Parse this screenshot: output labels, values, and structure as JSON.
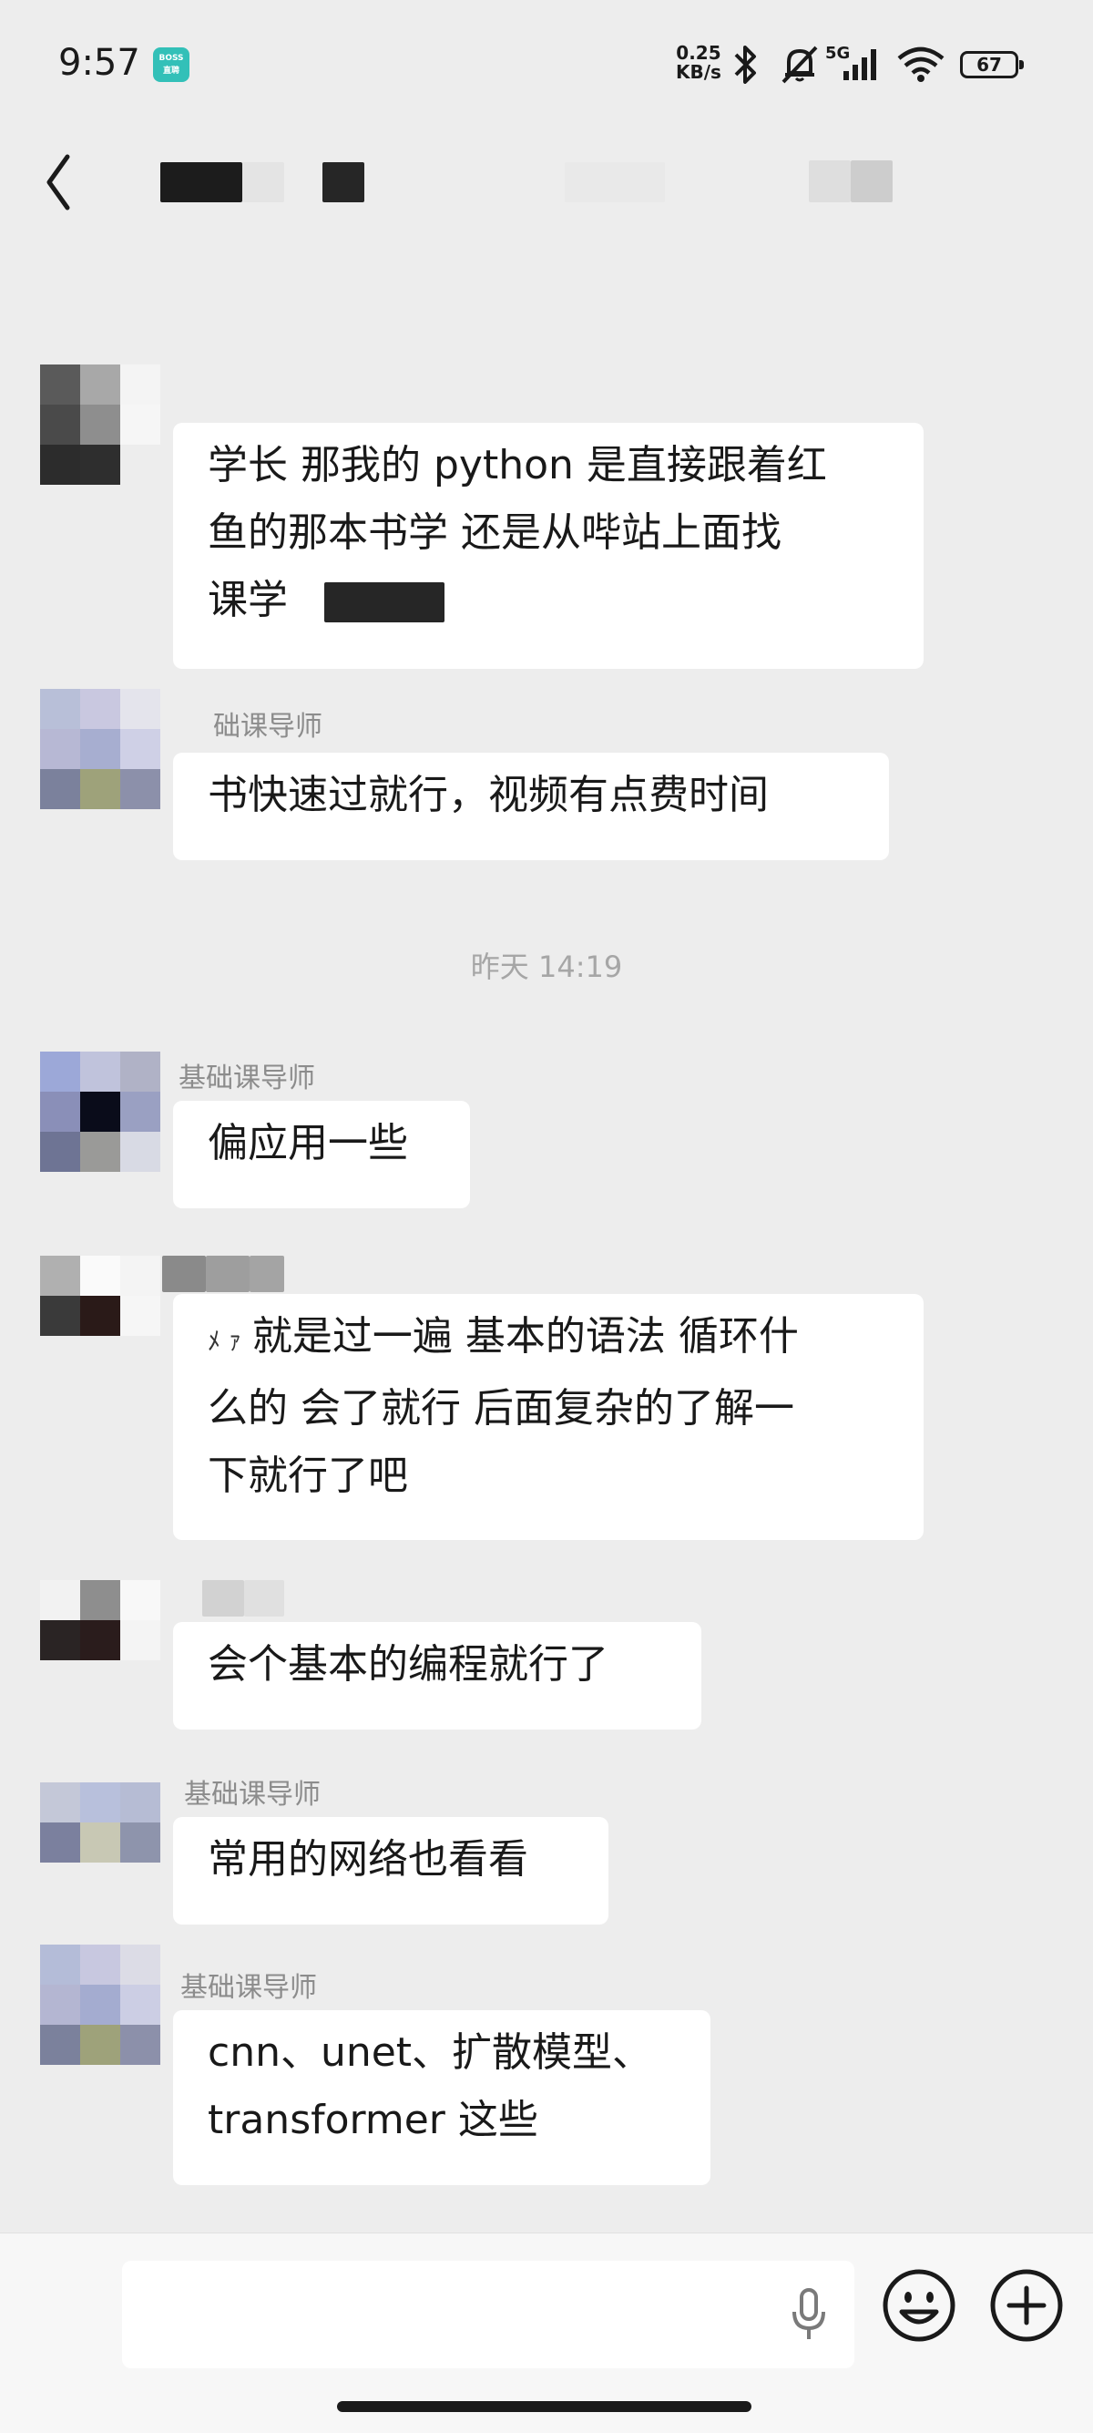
{
  "status_bar": {
    "time": "9:57",
    "boss_badge": "BOSS\n直聘",
    "net_speed_value": "0.25",
    "net_speed_unit": "KB/s",
    "network": "5G",
    "battery": "67",
    "icons": [
      "bluetooth-icon",
      "bell-muted-icon",
      "signal-icon",
      "wifi-icon",
      "battery-icon"
    ]
  },
  "header": {
    "back_icon": "chevron-left-icon"
  },
  "messages": [
    {
      "lines": [
        "学长 那我的 python 是直接跟着红",
        "鱼的那本书学 还是从哔站上面找",
        "课学"
      ]
    },
    {
      "sender": "础课导师",
      "lines": [
        "书快速过就行，视频有点费时间"
      ]
    },
    {
      "timestamp": "昨天 14:19"
    },
    {
      "sender": "基础课导师",
      "lines": [
        "偏应用一些"
      ]
    },
    {
      "lines": [
        "就是过一遍 基本的语法 循环什",
        "么的 会了就行 后面复杂的了解一",
        "下就行了吧"
      ]
    },
    {
      "lines": [
        "会个基本的编程就行了"
      ]
    },
    {
      "sender": "基础课导师",
      "lines": [
        "常用的网络也看看"
      ]
    },
    {
      "sender": "基础课导师",
      "lines": [
        "cnn、unet、扩散模型、",
        "transformer 这些"
      ]
    }
  ],
  "input_bar": {
    "mic_icon": "microphone-icon",
    "emoji_icon": "emoji-icon",
    "plus_icon": "plus-icon"
  },
  "colors": {
    "background": "#ededed",
    "bubble": "#ffffff",
    "text": "#191919",
    "meta_text": "#8c8c8c",
    "timestamp_text": "#a6a6a6",
    "input_bar": "#f7f7f7"
  }
}
